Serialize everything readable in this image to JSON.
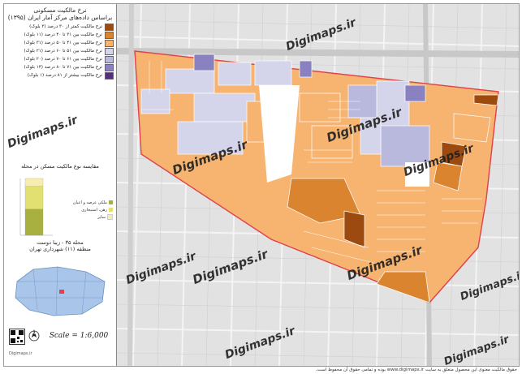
{
  "legend": {
    "title_line1": "نرخ مالکیت مسکونی",
    "title_line2": "براساس داده‌های مرکز آمار ایران (۱۳۹۵)",
    "items": [
      {
        "label": "نرخ مالکیت کمتر از ۳۰ درصد (۳ بلوک)",
        "color": "#9c4a10"
      },
      {
        "label": "نرخ مالکیت بین ۳۱ تا ۴۰ درصد (۱۱ بلوک)",
        "color": "#db8430"
      },
      {
        "label": "نرخ مالکیت بین ۴۱ تا ۵۰ درصد (۳۱ بلوک)",
        "color": "#f6b470"
      },
      {
        "label": "نرخ مالکیت بین ۵۱ تا ۶۰ درصد (۲۱ بلوک)",
        "color": "#d4d4ea"
      },
      {
        "label": "نرخ مالکیت بین ۶۱ تا ۷۰ درصد (۲۰ بلوک)",
        "color": "#b9b9dd"
      },
      {
        "label": "نرخ مالکیت بین ۷۱ تا ۸۰ درصد (۱۴ بلوک)",
        "color": "#8a82c0"
      },
      {
        "label": "نرخ مالکیت بیشتر از ۸۱ درصد (۱ بلوک)",
        "color": "#55307a"
      }
    ]
  },
  "tenure": {
    "title": "مقایسه نوع مالکیت مسکن در محله",
    "items": [
      {
        "label": "ملکی عرصه و اعیان",
        "color": "#a8b040"
      },
      {
        "label": "رهن، استیجاری",
        "color": "#e2e070"
      },
      {
        "label": "سایر",
        "color": "#f8ecb0"
      }
    ]
  },
  "chart_data": {
    "type": "bar",
    "title": "مقایسه نوع مالکیت مسکن در محله",
    "categories": [
      "محله"
    ],
    "series": [
      {
        "name": "ملکی عرصه و اعیان",
        "values": [
          46
        ]
      },
      {
        "name": "رهن، استیجاری",
        "values": [
          40
        ]
      },
      {
        "name": "سایر",
        "values": [
          14
        ]
      }
    ]
  },
  "location": {
    "neighborhood": "محله ۳۵ - زیبا دوست",
    "district": "منطقه (۱۱) شهرداری تهران"
  },
  "scale_text": "Scale = 1:6,000",
  "watermark": "Digimaps.ir",
  "footer_text": "حقوق مالکیت معنوی این محصول متعلق به سایت www.digimaps.ir بوده و تمامی حقوق آن محفوظ است.",
  "credit_text": "Digimaps.ir"
}
